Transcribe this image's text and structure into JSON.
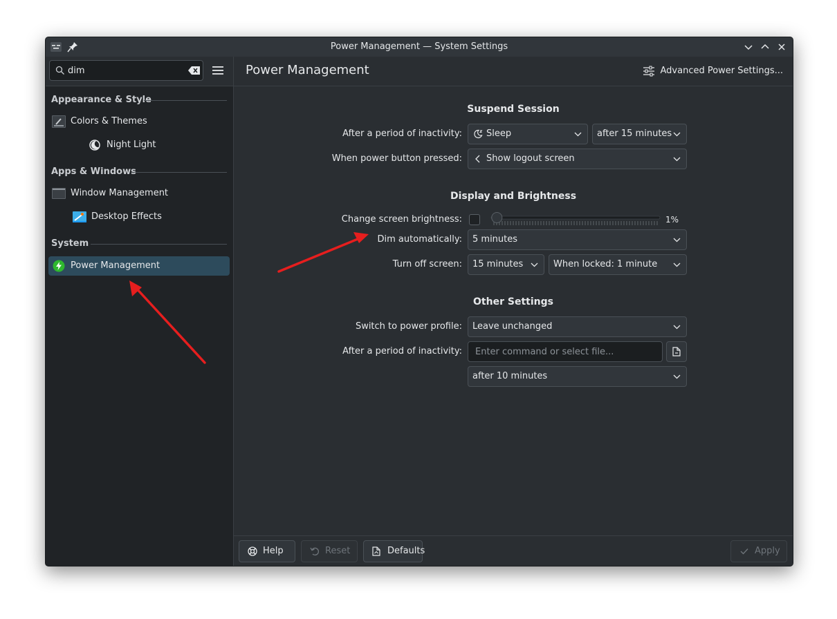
{
  "window": {
    "title": "Power Management — System Settings"
  },
  "sidebar": {
    "search": {
      "value": "dim",
      "placeholder": "Search…"
    },
    "sections": [
      {
        "label": "Appearance & Style"
      },
      {
        "label": "Apps & Windows"
      },
      {
        "label": "System"
      }
    ],
    "items": [
      {
        "label": "Colors & Themes"
      },
      {
        "label": "Night Light"
      },
      {
        "label": "Window Management"
      },
      {
        "label": "Desktop Effects"
      },
      {
        "label": "Power Management"
      }
    ]
  },
  "header": {
    "title": "Power Management",
    "advanced_label": "Advanced Power Settings..."
  },
  "suspend": {
    "title": "Suspend Session",
    "inactivity_label": "After a period of inactivity:",
    "inactivity_action": "Sleep",
    "inactivity_time": "after 15 minutes",
    "power_button_label": "When power button pressed:",
    "power_button_action": "Show logout screen"
  },
  "display": {
    "title": "Display and Brightness",
    "brightness_label": "Change screen brightness:",
    "brightness_value": "1%",
    "brightness_level": 0.01,
    "dim_label": "Dim automatically:",
    "dim_value": "5 minutes",
    "turnoff_label": "Turn off screen:",
    "turnoff_value": "15 minutes",
    "turnoff_locked": "When locked: 1 minute"
  },
  "other": {
    "title": "Other Settings",
    "profile_label": "Switch to power profile:",
    "profile_value": "Leave unchanged",
    "inactivity_label": "After a period of inactivity:",
    "command_placeholder": "Enter command or select file...",
    "command_time": "after 10 minutes"
  },
  "footer": {
    "help": "Help",
    "reset": "Reset",
    "defaults": "Defaults",
    "apply": "Apply"
  },
  "colors": {
    "window_bg": "#2a2e32",
    "sidebar_bg": "#202326",
    "active_item": "#2d4b5c",
    "accent": "#3daee9",
    "annotation": "#e61e1e"
  }
}
